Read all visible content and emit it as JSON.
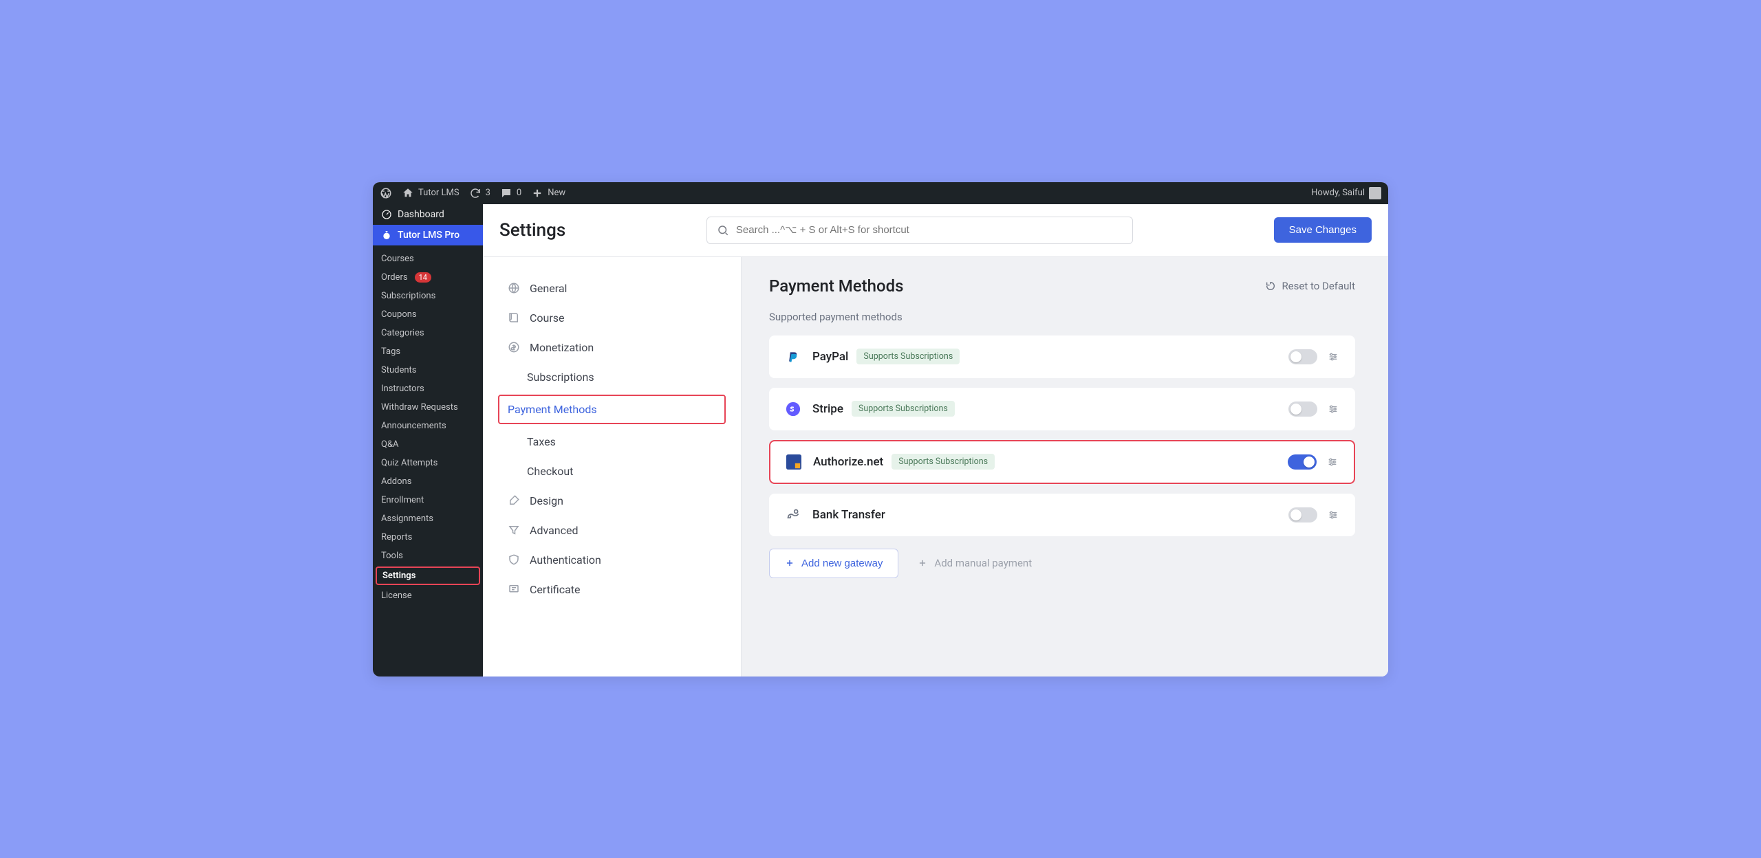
{
  "adminBar": {
    "siteName": "Tutor LMS",
    "updates": "3",
    "comments": "0",
    "new": "New",
    "greeting": "Howdy, Saiful"
  },
  "wpSidebar": {
    "dashboard": "Dashboard",
    "activeParent": "Tutor LMS Pro",
    "submenu": [
      {
        "label": "Courses"
      },
      {
        "label": "Orders",
        "badge": "14"
      },
      {
        "label": "Subscriptions"
      },
      {
        "label": "Coupons"
      },
      {
        "label": "Categories"
      },
      {
        "label": "Tags"
      },
      {
        "label": "Students"
      },
      {
        "label": "Instructors"
      },
      {
        "label": "Withdraw Requests"
      },
      {
        "label": "Announcements"
      },
      {
        "label": "Q&A"
      },
      {
        "label": "Quiz Attempts"
      },
      {
        "label": "Addons"
      },
      {
        "label": "Enrollment"
      },
      {
        "label": "Assignments"
      },
      {
        "label": "Reports"
      },
      {
        "label": "Tools"
      },
      {
        "label": "Settings",
        "highlighted": true
      },
      {
        "label": "License"
      }
    ]
  },
  "header": {
    "title": "Settings",
    "searchPlaceholder": "Search ...^⌥ + S or Alt+S for shortcut",
    "saveLabel": "Save Changes"
  },
  "settingsNav": [
    {
      "label": "General",
      "icon": "globe"
    },
    {
      "label": "Course",
      "icon": "book"
    },
    {
      "label": "Monetization",
      "icon": "money"
    },
    {
      "label": "Subscriptions",
      "sub": true
    },
    {
      "label": "Payment Methods",
      "sub": true,
      "active": true
    },
    {
      "label": "Taxes",
      "sub": true
    },
    {
      "label": "Checkout",
      "sub": true
    },
    {
      "label": "Design",
      "icon": "brush"
    },
    {
      "label": "Advanced",
      "icon": "filter"
    },
    {
      "label": "Authentication",
      "icon": "shield"
    },
    {
      "label": "Certificate",
      "icon": "cert"
    }
  ],
  "content": {
    "title": "Payment Methods",
    "reset": "Reset to Default",
    "subheading": "Supported payment methods",
    "methods": [
      {
        "name": "PayPal",
        "badge": "Supports Subscriptions",
        "on": false,
        "icon": "paypal"
      },
      {
        "name": "Stripe",
        "badge": "Supports Subscriptions",
        "on": false,
        "icon": "stripe"
      },
      {
        "name": "Authorize.net",
        "badge": "Supports Subscriptions",
        "on": true,
        "highlighted": true,
        "icon": "authorize"
      },
      {
        "name": "Bank Transfer",
        "on": false,
        "icon": "bank"
      }
    ],
    "addGateway": "Add new gateway",
    "addManual": "Add manual payment"
  }
}
